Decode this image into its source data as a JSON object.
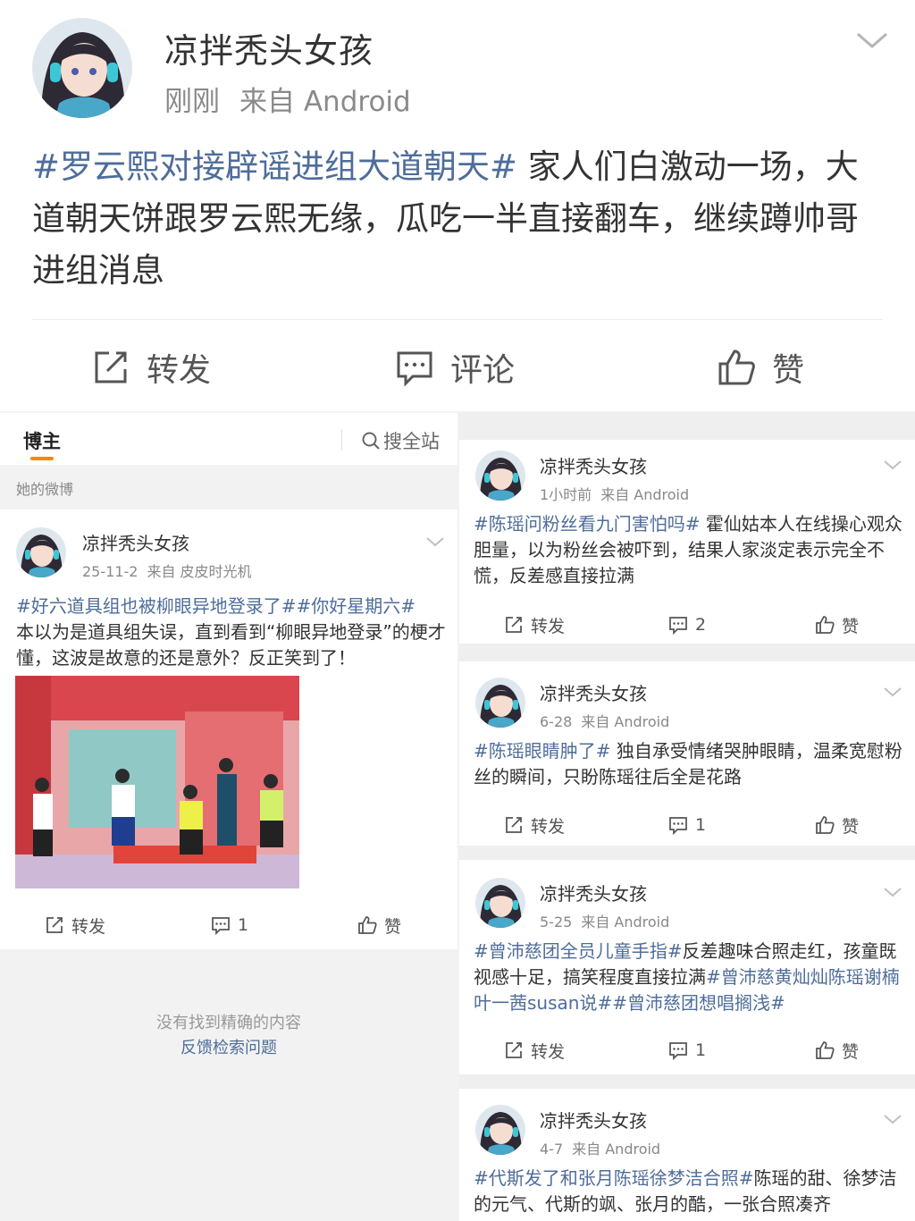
{
  "top_post": {
    "author": "凉拌秃头女孩",
    "time": "刚刚",
    "source": "来自 Android",
    "hashtag": "#罗云熙对接辟谣进组大道朝天#",
    "text": " 家人们白激动一场，大道朝天饼跟罗云熙无缘，瓜吃一半直接翻车，继续蹲帅哥进组消息",
    "actions": {
      "repost": "转发",
      "comment": "评论",
      "like": "赞"
    }
  },
  "left_panel": {
    "tab_blogger": "博主",
    "search_all": "搜全站",
    "section_label": "她的微博",
    "post": {
      "author": "凉拌秃头女孩",
      "time": "25-11-2",
      "source": "来自 皮皮时光机",
      "hashtag": "#好六道具组也被柳眼异地登录了##你好星期六#",
      "text": "本以为是道具组失误，直到看到“柳眼异地登录”的梗才懂，这波是故意的还是意外？反正笑到了！",
      "repost": "转发",
      "comments": "1",
      "like": "赞"
    },
    "no_result": "没有找到精确的内容",
    "feedback": "反馈检索问题"
  },
  "right_panel": {
    "posts": [
      {
        "author": "凉拌秃头女孩",
        "time": "1小时前",
        "source": "来自 Android",
        "hashtag": "#陈瑶问粉丝看九门害怕吗#",
        "text": " 霍仙姑本人在线操心观众胆量，以为粉丝会被吓到，结果人家淡定表示完全不慌，反差感直接拉满",
        "repost": "转发",
        "comments": "2",
        "like": "赞"
      },
      {
        "author": "凉拌秃头女孩",
        "time": "6-28",
        "source": "来自 Android",
        "hashtag": "#陈瑶眼睛肿了#",
        "text": " 独自承受情绪哭肿眼睛，温柔宽慰粉丝的瞬间，只盼陈瑶往后全是花路",
        "repost": "转发",
        "comments": "1",
        "like": "赞"
      },
      {
        "author": "凉拌秃头女孩",
        "time": "5-25",
        "source": "来自 Android",
        "hashtag": "#曾沛慈团全员儿童手指#",
        "text": "反差趣味合照走红，孩童既视感十足，搞笑程度直接拉满",
        "hashtag2": "#曾沛慈黄灿灿陈瑶谢楠叶一茜susan说##曾沛慈团想唱搁浅#",
        "repost": "转发",
        "comments": "1",
        "like": "赞"
      },
      {
        "author": "凉拌秃头女孩",
        "time": "4-7",
        "source": "来自 Android",
        "hashtag": "#代斯发了和张月陈瑶徐梦洁合照#",
        "text": "陈瑶的甜、徐梦洁的元气、代斯的飒、张月的酷，一张合照凑齐"
      }
    ]
  },
  "colors": {
    "link": "#4f6d9a",
    "accent": "#ff8200",
    "muted": "#8a8a8a"
  },
  "icons": [
    "avatar-anime-girl-headphones",
    "chevron-down-icon",
    "repost-icon",
    "comment-icon",
    "like-icon",
    "search-icon"
  ]
}
